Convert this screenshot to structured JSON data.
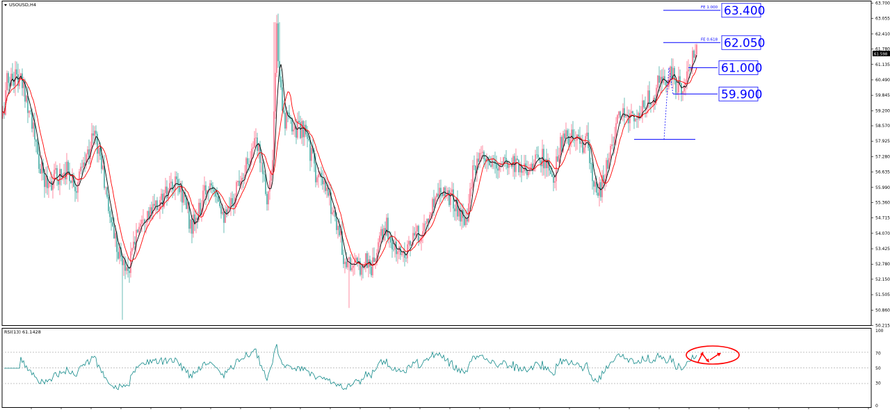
{
  "header": {
    "symbol_label": "USOUSD,H4",
    "rsi_label": "RSI(13) 61.1428"
  },
  "current_price": "61.598",
  "fe_labels": [
    "FE 1.000",
    "FE 0.618"
  ],
  "levels": [
    "63.400",
    "62.050",
    "61.000",
    "59.900"
  ],
  "colors": {
    "background": "#ffffff",
    "bull_candle": "#ff5a7a",
    "bear_candle": "#2aa198",
    "ma_fast": "#000000",
    "ma_slow": "#ff0000",
    "rsi_line": "#138a8a",
    "levels": "#0000ff",
    "annotation": "#ff0000"
  },
  "chart_data": [
    {
      "type": "candlestick",
      "panel": "price",
      "title": "USOUSD,H4",
      "ylim": [
        50.215,
        63.7
      ],
      "y_ticks": [
        "63.700",
        "63.055",
        "62.410",
        "61.780",
        "61.135",
        "60.490",
        "59.845",
        "59.200",
        "58.570",
        "57.925",
        "57.280",
        "56.635",
        "55.990",
        "55.360",
        "54.715",
        "54.070",
        "53.425",
        "52.780",
        "52.150",
        "51.505",
        "50.860",
        "50.215"
      ],
      "close_path": [
        [
          0,
          58.0
        ],
        [
          10,
          60.4
        ],
        [
          22,
          60.7
        ],
        [
          35,
          60.1
        ],
        [
          45,
          59.0
        ],
        [
          55,
          57.0
        ],
        [
          65,
          56.2
        ],
        [
          80,
          56.4
        ],
        [
          95,
          56.8
        ],
        [
          110,
          56.1
        ],
        [
          122,
          57.0
        ],
        [
          135,
          58.3
        ],
        [
          145,
          57.2
        ],
        [
          155,
          55.2
        ],
        [
          165,
          54.0
        ],
        [
          175,
          52.9
        ],
        [
          185,
          52.6
        ],
        [
          195,
          54.0
        ],
        [
          205,
          55.0
        ],
        [
          215,
          54.8
        ],
        [
          228,
          55.3
        ],
        [
          240,
          55.7
        ],
        [
          255,
          56.1
        ],
        [
          265,
          55.6
        ],
        [
          275,
          54.3
        ],
        [
          285,
          54.8
        ],
        [
          295,
          55.8
        ],
        [
          305,
          56.4
        ],
        [
          315,
          55.6
        ],
        [
          325,
          54.6
        ],
        [
          335,
          55.5
        ],
        [
          345,
          56.5
        ],
        [
          355,
          57.0
        ],
        [
          365,
          57.8
        ],
        [
          375,
          57.4
        ],
        [
          385,
          55.5
        ],
        [
          392,
          57.0
        ],
        [
          398,
          62.5
        ],
        [
          402,
          60.5
        ],
        [
          410,
          58.8
        ],
        [
          420,
          58.6
        ],
        [
          432,
          58.4
        ],
        [
          442,
          58.0
        ],
        [
          455,
          56.5
        ],
        [
          465,
          56.0
        ],
        [
          475,
          55.4
        ],
        [
          485,
          54.5
        ],
        [
          495,
          53.0
        ],
        [
          505,
          52.8
        ],
        [
          515,
          52.6
        ],
        [
          525,
          53.0
        ],
        [
          535,
          52.6
        ],
        [
          545,
          53.6
        ],
        [
          555,
          54.4
        ],
        [
          565,
          53.5
        ],
        [
          575,
          53.2
        ],
        [
          585,
          53.5
        ],
        [
          595,
          53.8
        ],
        [
          605,
          54.1
        ],
        [
          615,
          54.5
        ],
        [
          625,
          55.6
        ],
        [
          635,
          56.1
        ],
        [
          645,
          55.7
        ],
        [
          655,
          55.3
        ],
        [
          665,
          54.7
        ],
        [
          672,
          55.0
        ],
        [
          680,
          56.5
        ],
        [
          690,
          57.1
        ],
        [
          700,
          57.0
        ],
        [
          712,
          56.8
        ],
        [
          722,
          56.9
        ],
        [
          735,
          57.1
        ],
        [
          745,
          57.0
        ],
        [
          755,
          56.8
        ],
        [
          768,
          57.0
        ],
        [
          778,
          57.3
        ],
        [
          788,
          56.8
        ],
        [
          795,
          55.9
        ],
        [
          802,
          57.5
        ],
        [
          812,
          58.0
        ],
        [
          822,
          58.0
        ],
        [
          835,
          57.8
        ],
        [
          845,
          57.9
        ],
        [
          852,
          56.0
        ],
        [
          862,
          55.8
        ],
        [
          870,
          56.5
        ],
        [
          880,
          57.9
        ],
        [
          890,
          58.8
        ],
        [
          900,
          59.0
        ],
        [
          910,
          59.1
        ],
        [
          918,
          58.9
        ],
        [
          928,
          59.4
        ],
        [
          938,
          59.9
        ],
        [
          948,
          60.3
        ],
        [
          958,
          60.4
        ],
        [
          965,
          60.8
        ],
        [
          972,
          60.2
        ],
        [
          980,
          60.2
        ],
        [
          990,
          60.9
        ],
        [
          997,
          61.4
        ],
        [
          1002,
          61.6
        ]
      ],
      "series": [
        {
          "name": "ma_fast",
          "color": "#000000"
        },
        {
          "name": "ma_slow",
          "color": "#ff0000"
        }
      ],
      "annotations": {
        "levels": [
          {
            "label": "FE 1.000",
            "price": 63.4,
            "value_text": "63.400"
          },
          {
            "label": "FE 0.618",
            "price": 62.05,
            "value_text": "62.050"
          },
          {
            "price": 61.0,
            "value_text": "61.000"
          },
          {
            "price": 59.9,
            "value_text": "59.900"
          }
        ],
        "swing_low": 58.0,
        "swing_high": 61.6,
        "current_price": 61.598
      }
    },
    {
      "type": "line",
      "panel": "rsi",
      "title": "RSI(13) 61.1428",
      "ylim": [
        0,
        100
      ],
      "y_ticks": [
        "100",
        "70",
        "50",
        "30",
        "0"
      ],
      "reference_lines": [
        70,
        50,
        30
      ],
      "grid": false
    }
  ]
}
